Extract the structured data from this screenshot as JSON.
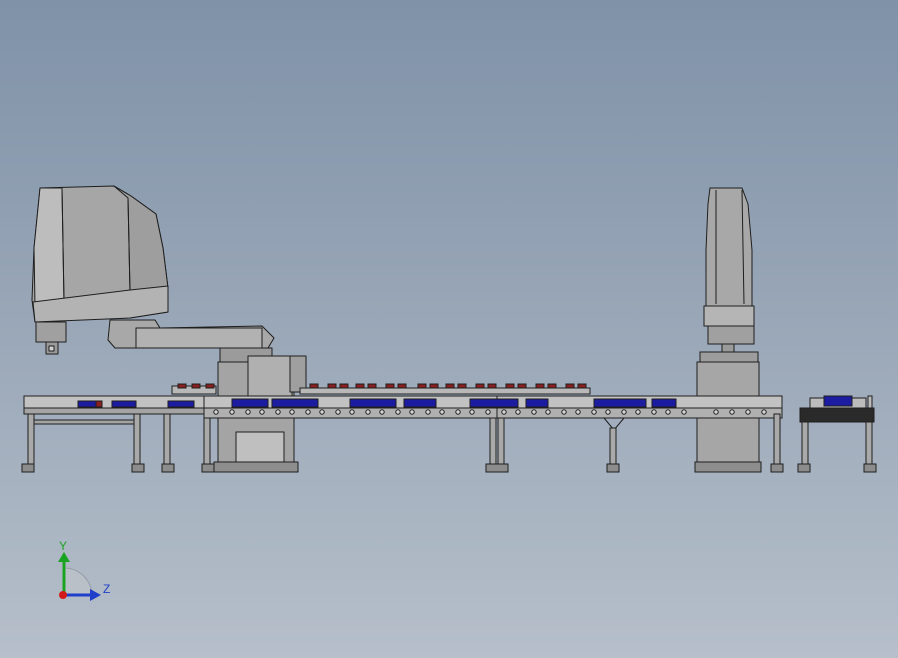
{
  "scene": {
    "view": "side",
    "objects": [
      "scara-robot-left",
      "scara-robot-right",
      "conveyor-left",
      "conveyor-right",
      "small-conveyor"
    ]
  },
  "triad": {
    "y_label": "Y",
    "z_label": "Z",
    "y_color": "#1aa321",
    "z_color": "#1f3ec9",
    "origin_color": "#d11b1b"
  },
  "colors": {
    "metal": "#a9a9a9",
    "metal_light": "#c4c4c4",
    "metal_dark": "#8a8a8a",
    "outline": "#1e1e1e",
    "part_blue": "#1c1ca0",
    "part_red": "#8a1f1f",
    "belt_dark": "#2a2a2a"
  }
}
